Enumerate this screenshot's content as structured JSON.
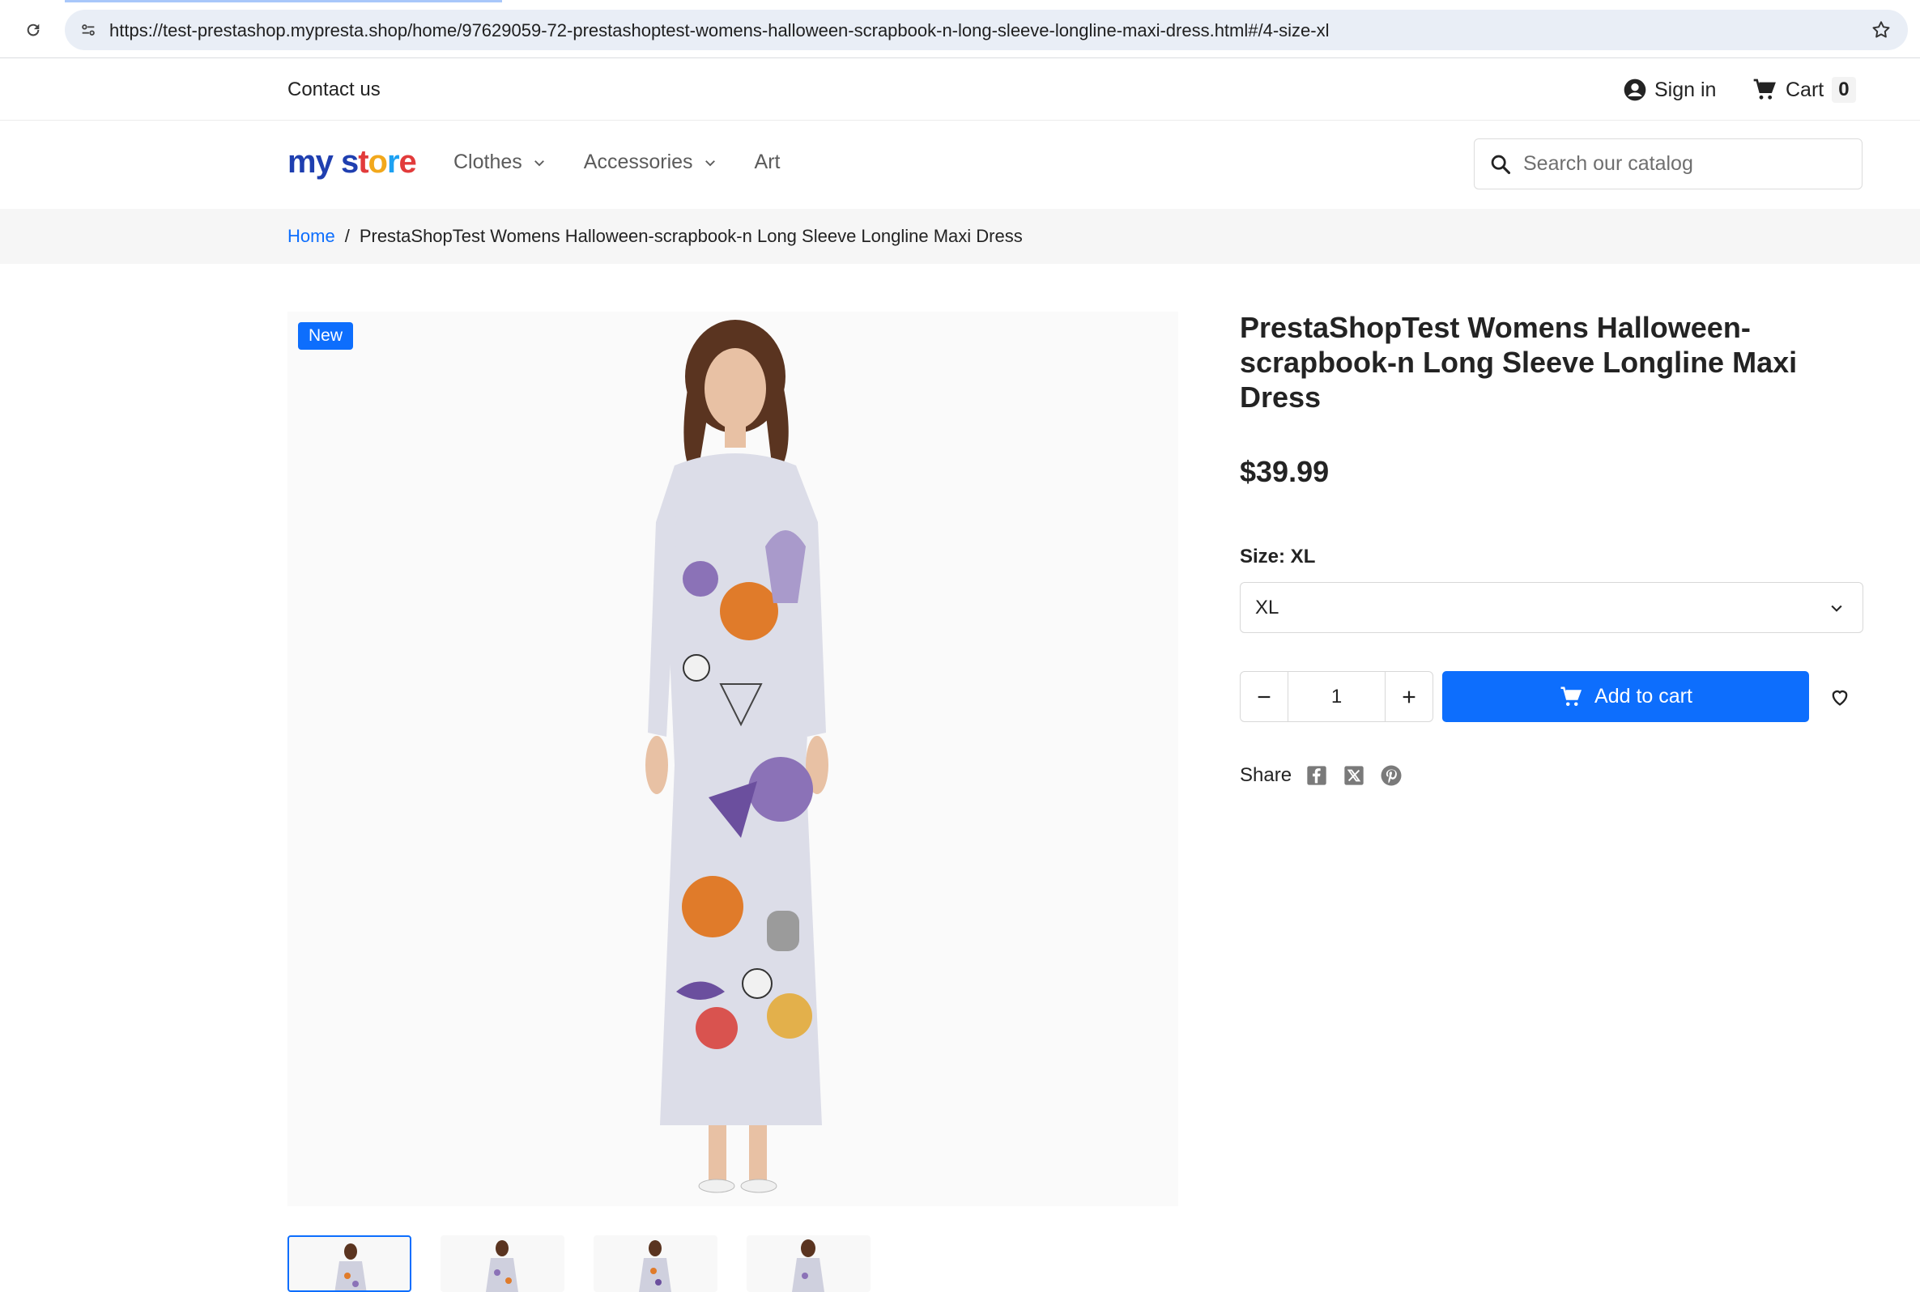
{
  "browser": {
    "url": "https://test-prestashop.mypresta.shop/home/97629059-72-prestashoptest-womens-halloween-scrapbook-n-long-sleeve-longline-maxi-dress.html#/4-size-xl"
  },
  "header": {
    "contact_label": "Contact us",
    "signin_label": "Sign in",
    "cart_label": "Cart",
    "cart_count": "0"
  },
  "nav": {
    "logo_my": "my",
    "logo_store": [
      "s",
      "t",
      "o",
      "r",
      "e"
    ],
    "menu": [
      {
        "label": "Clothes",
        "dropdown": true
      },
      {
        "label": "Accessories",
        "dropdown": true
      },
      {
        "label": "Art",
        "dropdown": false
      }
    ],
    "search_placeholder": "Search our catalog"
  },
  "breadcrumb": {
    "home": "Home",
    "separator": "/",
    "current": "PrestaShopTest Womens Halloween-scrapbook-n Long Sleeve Longline Maxi Dress"
  },
  "product": {
    "badge": "New",
    "title": "PrestaShopTest Womens Halloween-scrapbook-n Long Sleeve Longline Maxi Dress",
    "price": "$39.99",
    "size_label": "Size: XL",
    "size_selected": "XL",
    "quantity": "1",
    "add_to_cart": "Add to cart",
    "share_label": "Share",
    "share_icons": [
      "facebook-icon",
      "x-icon",
      "pinterest-icon"
    ],
    "thumbnail_count": 4
  },
  "colors": {
    "primary": "#0d6efd",
    "text": "#232323"
  }
}
